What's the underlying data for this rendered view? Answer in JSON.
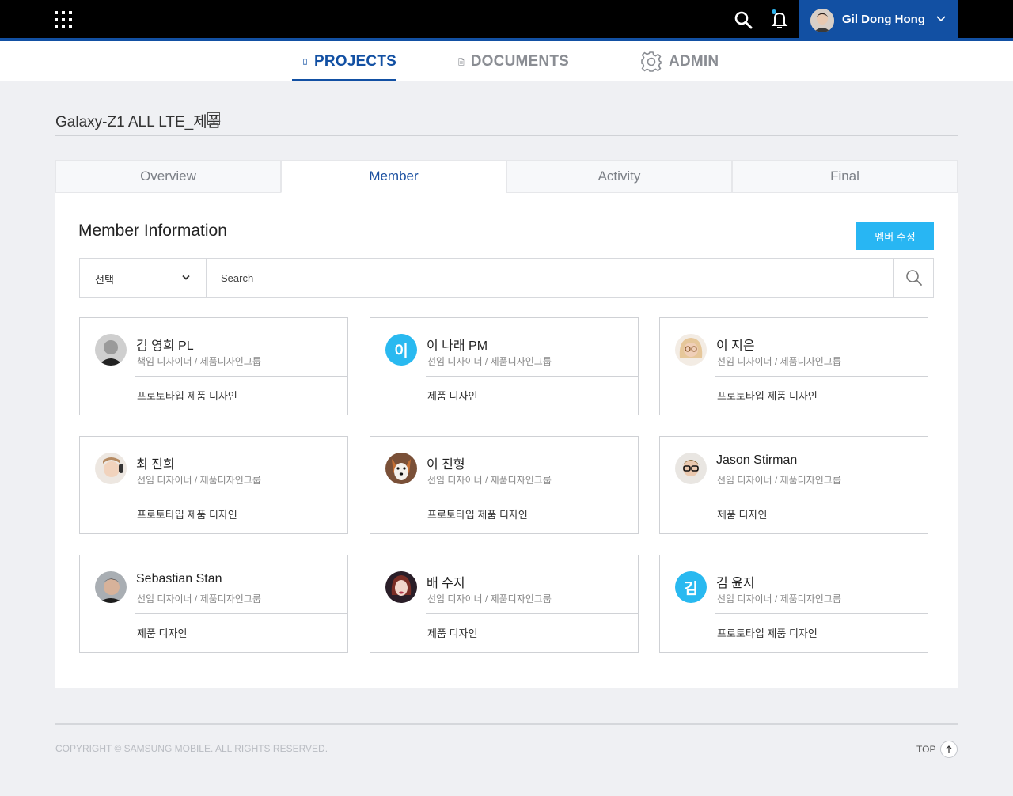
{
  "header": {
    "user_name": "Gil Dong Hong"
  },
  "nav": {
    "items": [
      {
        "label": "PROJECTS",
        "icon": "phone-icon",
        "active": true
      },
      {
        "label": "DOCUMENTS",
        "icon": "document-icon",
        "active": false
      },
      {
        "label": "ADMIN",
        "icon": "gear-icon",
        "active": false
      }
    ]
  },
  "project": {
    "title": "Galaxy-Z1 ALL LTE_제품"
  },
  "tabs": [
    {
      "label": "Overview",
      "active": false
    },
    {
      "label": "Member",
      "active": true
    },
    {
      "label": "Activity",
      "active": false
    },
    {
      "label": "Final",
      "active": false
    }
  ],
  "member_panel": {
    "title": "Member Information",
    "edit_button": "멤버 수정",
    "select_value": "선택",
    "search_placeholder": "Search"
  },
  "members": [
    {
      "name": "김 영희 PL",
      "role": "책임 디자이너 / 제품디자인그룹",
      "task": "프로토타입 제품 디자인",
      "avatar": "photo-bald-man"
    },
    {
      "name": "이 나래 PM",
      "role": "선임 디자이너 / 제품디자인그룹",
      "task": "제품 디자인",
      "avatar_initial": "이"
    },
    {
      "name": "이 지은",
      "role": "선임 디자이너 / 제품디자인그룹",
      "task": "프로토타입 제품 디자인",
      "avatar": "photo-blonde-woman-glasses"
    },
    {
      "name": "최 진희",
      "role": "선임 디자이너 / 제품디자인그룹",
      "task": "프로토타입 제품 디자인",
      "avatar": "photo-woman-headphones"
    },
    {
      "name": "이 진형",
      "role": "선임 디자이너 / 제품디자인그룹",
      "task": "프로토타입 제품 디자인",
      "avatar": "photo-dog"
    },
    {
      "name": "Jason Stirman",
      "role": "선임 디자이너 / 제품디자인그룹",
      "task": "제품 디자인",
      "avatar": "photo-man-glasses"
    },
    {
      "name": "Sebastian Stan",
      "role": "선임 디자이너 / 제품디자인그룹",
      "task": "제품 디자인",
      "avatar": "photo-man"
    },
    {
      "name": "배 수지",
      "role": "선임 디자이너 / 제품디자인그룹",
      "task": "제품 디자인",
      "avatar": "photo-woman-red-hair"
    },
    {
      "name": "김 윤지",
      "role": "선임 디자이너 / 제품디자인그룹",
      "task": "프로토타입 제품 디자인",
      "avatar_initial": "김"
    }
  ],
  "footer": {
    "copyright": "COPYRIGHT © SAMSUNG MOBILE. ALL RIGHTS RESERVED.",
    "top_label": "TOP"
  },
  "colors": {
    "brand_blue": "#1250a3",
    "accent_cyan": "#28b6f3"
  }
}
